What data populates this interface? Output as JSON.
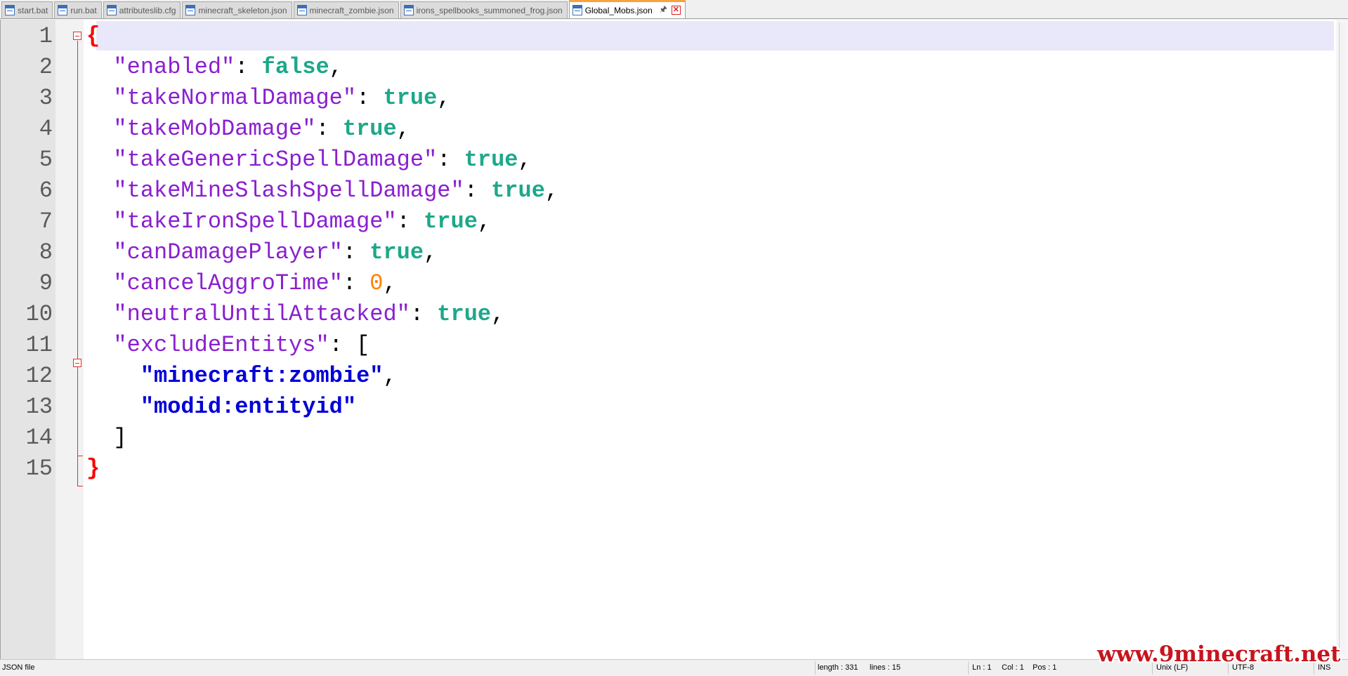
{
  "tabs": [
    {
      "label": "start.bat",
      "active": false
    },
    {
      "label": "run.bat",
      "active": false
    },
    {
      "label": "attributeslib.cfg",
      "active": false
    },
    {
      "label": "minecraft_skeleton.json",
      "active": false
    },
    {
      "label": "minecraft_zombie.json",
      "active": false
    },
    {
      "label": "irons_spellbooks_summoned_frog.json",
      "active": false
    },
    {
      "label": "Global_Mobs.json",
      "active": true
    }
  ],
  "editor": {
    "line_numbers": [
      "1",
      "2",
      "3",
      "4",
      "5",
      "6",
      "7",
      "8",
      "9",
      "10",
      "11",
      "12",
      "13",
      "14",
      "15"
    ],
    "lines": [
      [
        {
          "t": "{",
          "c": "brace"
        }
      ],
      [
        {
          "t": "  "
        },
        {
          "t": "\"enabled\"",
          "c": "key"
        },
        {
          "t": ": "
        },
        {
          "t": "false",
          "c": "bool"
        },
        {
          "t": ","
        }
      ],
      [
        {
          "t": "  "
        },
        {
          "t": "\"takeNormalDamage\"",
          "c": "key"
        },
        {
          "t": ": "
        },
        {
          "t": "true",
          "c": "bool"
        },
        {
          "t": ","
        }
      ],
      [
        {
          "t": "  "
        },
        {
          "t": "\"takeMobDamage\"",
          "c": "key"
        },
        {
          "t": ": "
        },
        {
          "t": "true",
          "c": "bool"
        },
        {
          "t": ","
        }
      ],
      [
        {
          "t": "  "
        },
        {
          "t": "\"takeGenericSpellDamage\"",
          "c": "key"
        },
        {
          "t": ": "
        },
        {
          "t": "true",
          "c": "bool"
        },
        {
          "t": ","
        }
      ],
      [
        {
          "t": "  "
        },
        {
          "t": "\"takeMineSlashSpellDamage\"",
          "c": "key"
        },
        {
          "t": ": "
        },
        {
          "t": "true",
          "c": "bool"
        },
        {
          "t": ","
        }
      ],
      [
        {
          "t": "  "
        },
        {
          "t": "\"takeIronSpellDamage\"",
          "c": "key"
        },
        {
          "t": ": "
        },
        {
          "t": "true",
          "c": "bool"
        },
        {
          "t": ","
        }
      ],
      [
        {
          "t": "  "
        },
        {
          "t": "\"canDamagePlayer\"",
          "c": "key"
        },
        {
          "t": ": "
        },
        {
          "t": "true",
          "c": "bool"
        },
        {
          "t": ","
        }
      ],
      [
        {
          "t": "  "
        },
        {
          "t": "\"cancelAggroTime\"",
          "c": "key"
        },
        {
          "t": ": "
        },
        {
          "t": "0",
          "c": "num"
        },
        {
          "t": ","
        }
      ],
      [
        {
          "t": "  "
        },
        {
          "t": "\"neutralUntilAttacked\"",
          "c": "key"
        },
        {
          "t": ": "
        },
        {
          "t": "true",
          "c": "bool"
        },
        {
          "t": ","
        }
      ],
      [
        {
          "t": "  "
        },
        {
          "t": "\"excludeEntitys\"",
          "c": "key"
        },
        {
          "t": ": ["
        }
      ],
      [
        {
          "t": "    "
        },
        {
          "t": "\"minecraft:zombie\"",
          "c": "str"
        },
        {
          "t": ","
        }
      ],
      [
        {
          "t": "    "
        },
        {
          "t": "\"modid:entityid\"",
          "c": "str"
        }
      ],
      [
        {
          "t": "  ]"
        }
      ],
      [
        {
          "t": "}",
          "c": "brace"
        }
      ]
    ]
  },
  "statusbar": {
    "file_type": "JSON file",
    "length": "length : 331",
    "lines": "lines : 15",
    "ln": "Ln : 1",
    "col": "Col : 1",
    "pos": "Pos : 1",
    "eol": "Unix (LF)",
    "encoding": "UTF-8",
    "mode": "INS"
  },
  "watermark": "www.9minecraft.net",
  "colors": {
    "key": "#8a1fcf",
    "bool": "#1da88a",
    "number": "#ff8000",
    "string": "#0000d8",
    "brace": "#ff0000",
    "active_tab_accent": "#f9a23c",
    "current_line": "#e8e8fa"
  }
}
